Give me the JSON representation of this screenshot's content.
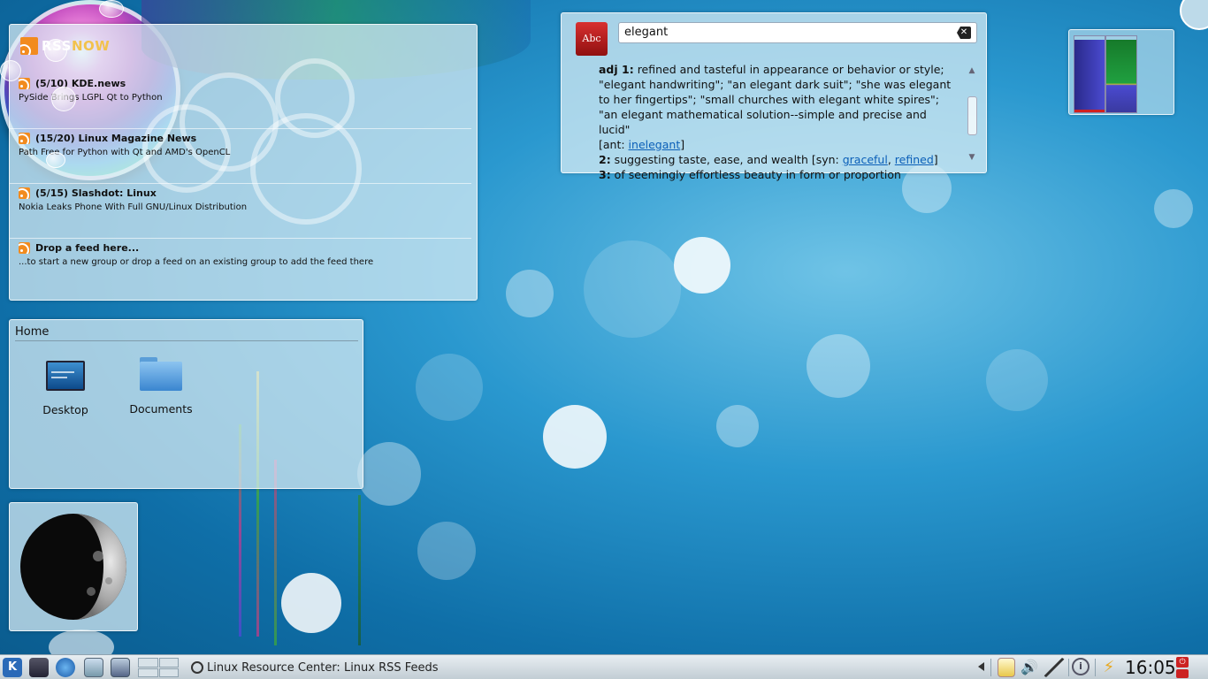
{
  "rss": {
    "logo": {
      "rss": "RSS",
      "now": "NOW"
    },
    "feeds": [
      {
        "title": "(5/10) KDE.news",
        "desc": "PySide Brings LGPL Qt to Python"
      },
      {
        "title": "(15/20) Linux Magazine News",
        "desc": "Path Free for Python with Qt and AMD's OpenCL"
      },
      {
        "title": "(5/15) Slashdot: Linux",
        "desc": "Nokia Leaks Phone With Full GNU/Linux Distribution"
      },
      {
        "title": "Drop a feed here...",
        "desc": "...to start a new group or drop a feed on an existing group to add the feed there"
      }
    ]
  },
  "dictionary": {
    "icon_label": "Abc",
    "query": "elegant",
    "def1_num": "adj 1:",
    "def1_text": " refined and tasteful in appearance or behavior or style; \"elegant handwriting\"; \"an elegant dark suit\"; \"she was elegant to her fingertips\"; \"small churches with elegant white spires\"; \"an elegant mathematical solution--simple and precise and lucid\"",
    "ant_prefix": "[ant: ",
    "ant_link": "inelegant",
    "ant_suffix": "]",
    "def2_num": "2:",
    "def2_text": " suggesting taste, ease, and wealth [syn: ",
    "syn_link1": "graceful",
    "syn_sep": ", ",
    "syn_link2": "refined",
    "syn_suffix": "]",
    "def3_num": "3:",
    "def3_text": " of seemingly effortless beauty in form or proportion"
  },
  "home": {
    "title": "Home",
    "files": [
      {
        "label": "Desktop"
      },
      {
        "label": "Documents"
      }
    ]
  },
  "sysmon": {
    "bar1_level": 0.95,
    "bar2_level": 0.95
  },
  "taskbar": {
    "task_label": "Linux Resource Center: Linux RSS Feeds",
    "clock": "16:05"
  },
  "colors": {
    "accent": "#2a98cf",
    "link": "#0b5fb8",
    "rss": "#f28b1e"
  }
}
